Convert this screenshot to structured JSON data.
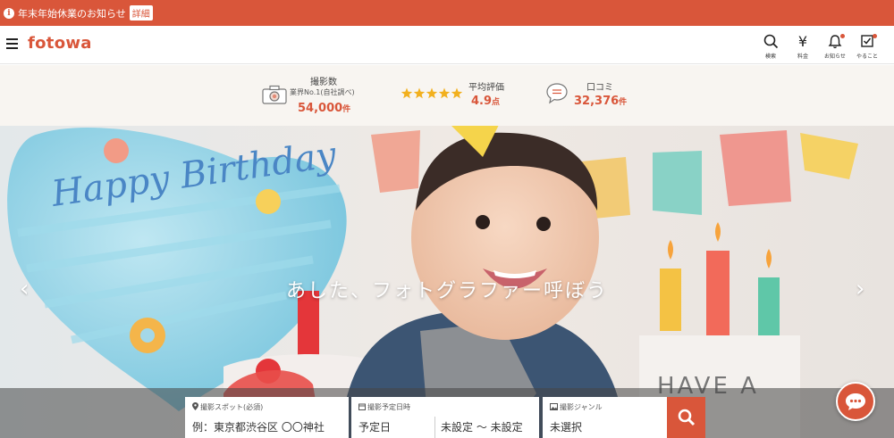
{
  "notice": {
    "text": "年末年始休業のお知らせ",
    "detail_label": "詳細"
  },
  "header": {
    "logo": "fotowa",
    "icons": [
      {
        "name": "search-icon",
        "label": "検索"
      },
      {
        "name": "yen-icon",
        "glyph": "¥",
        "label": "料金"
      },
      {
        "name": "bell-icon",
        "label": "お知らせ"
      },
      {
        "name": "checklist-icon",
        "label": "やること"
      }
    ]
  },
  "stats": {
    "shots": {
      "title": "撮影数",
      "sub": "業界No.1(自社調べ)",
      "value": "54,000",
      "unit": "件"
    },
    "rating": {
      "title": "平均評価",
      "value": "4.9",
      "unit": "点",
      "stars": 5
    },
    "reviews": {
      "title": "口コミ",
      "value": "32,376",
      "unit": "件"
    }
  },
  "hero": {
    "title": "あした、フォトグラファー呼ぼう",
    "prev": "‹",
    "next": "›",
    "balloon_text": "Happy Birthday",
    "banner_text": "HAVE A"
  },
  "search": {
    "spot_label": "撮影スポット(必須)",
    "spot_placeholder": "例：東京都渋谷区 〇〇神社",
    "date_label": "撮影予定日時",
    "date_value": "予定日",
    "time_value": "未設定 ～ 未設定",
    "genre_label": "撮影ジャンル",
    "genre_value": "未選択"
  },
  "colors": {
    "accent": "#d9563a"
  }
}
